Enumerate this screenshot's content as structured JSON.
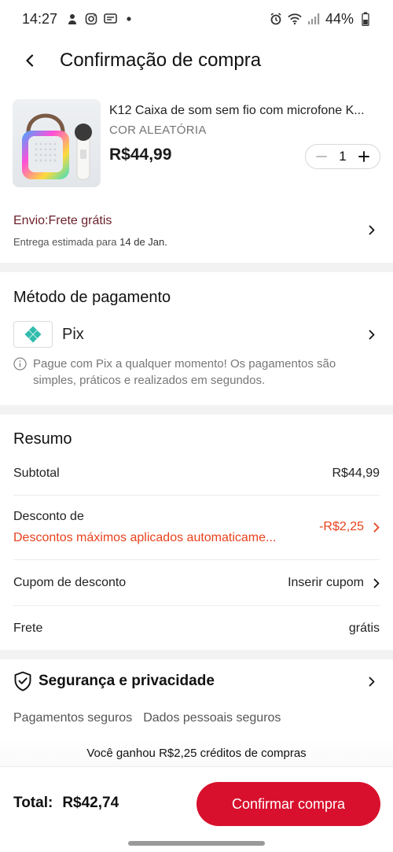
{
  "status_bar": {
    "time": "14:27",
    "battery": "44%"
  },
  "header": {
    "title": "Confirmação de compra"
  },
  "product": {
    "title": "K12 Caixa de som sem fio com microfone K...",
    "variant": "COR ALEATÓRIA",
    "price": "R$44,99",
    "quantity": "1"
  },
  "shipping": {
    "label": "Envio:Frete grátis",
    "estimate_prefix": "Entrega estimada para ",
    "estimate_date": "14 de Jan."
  },
  "payment": {
    "title": "Método de pagamento",
    "method": "Pix",
    "info": "Pague com Pix a qualquer momento! Os pagamentos são simples, práticos e realizados em segundos."
  },
  "summary": {
    "title": "Resumo",
    "subtotal_label": "Subtotal",
    "subtotal_value": "R$44,99",
    "discount_label": "Desconto de",
    "discount_note": "Descontos máximos aplicados automaticame...",
    "discount_value": "-R$2,25",
    "coupon_label": "Cupom de desconto",
    "coupon_action": "Inserir cupom",
    "shipping_label": "Frete",
    "shipping_value": "grátis"
  },
  "security": {
    "title": "Segurança e privacidade",
    "items": [
      "Pagamentos seguros",
      "Dados pessoais seguros"
    ]
  },
  "credit_banner": "Você ganhou R$2,25 créditos de compras",
  "footer": {
    "total_label": "Total:",
    "total_value": "R$42,74",
    "confirm_label": "Confirmar compra"
  },
  "colors": {
    "accent": "#d8102d",
    "discount": "#e8421d",
    "shipping_text": "#6b1f2a",
    "pix": "#32bcad"
  },
  "icons": [
    "back-arrow-icon",
    "minus-icon",
    "plus-icon",
    "chevron-right-icon",
    "pix-icon",
    "info-icon",
    "shield-check-icon"
  ]
}
